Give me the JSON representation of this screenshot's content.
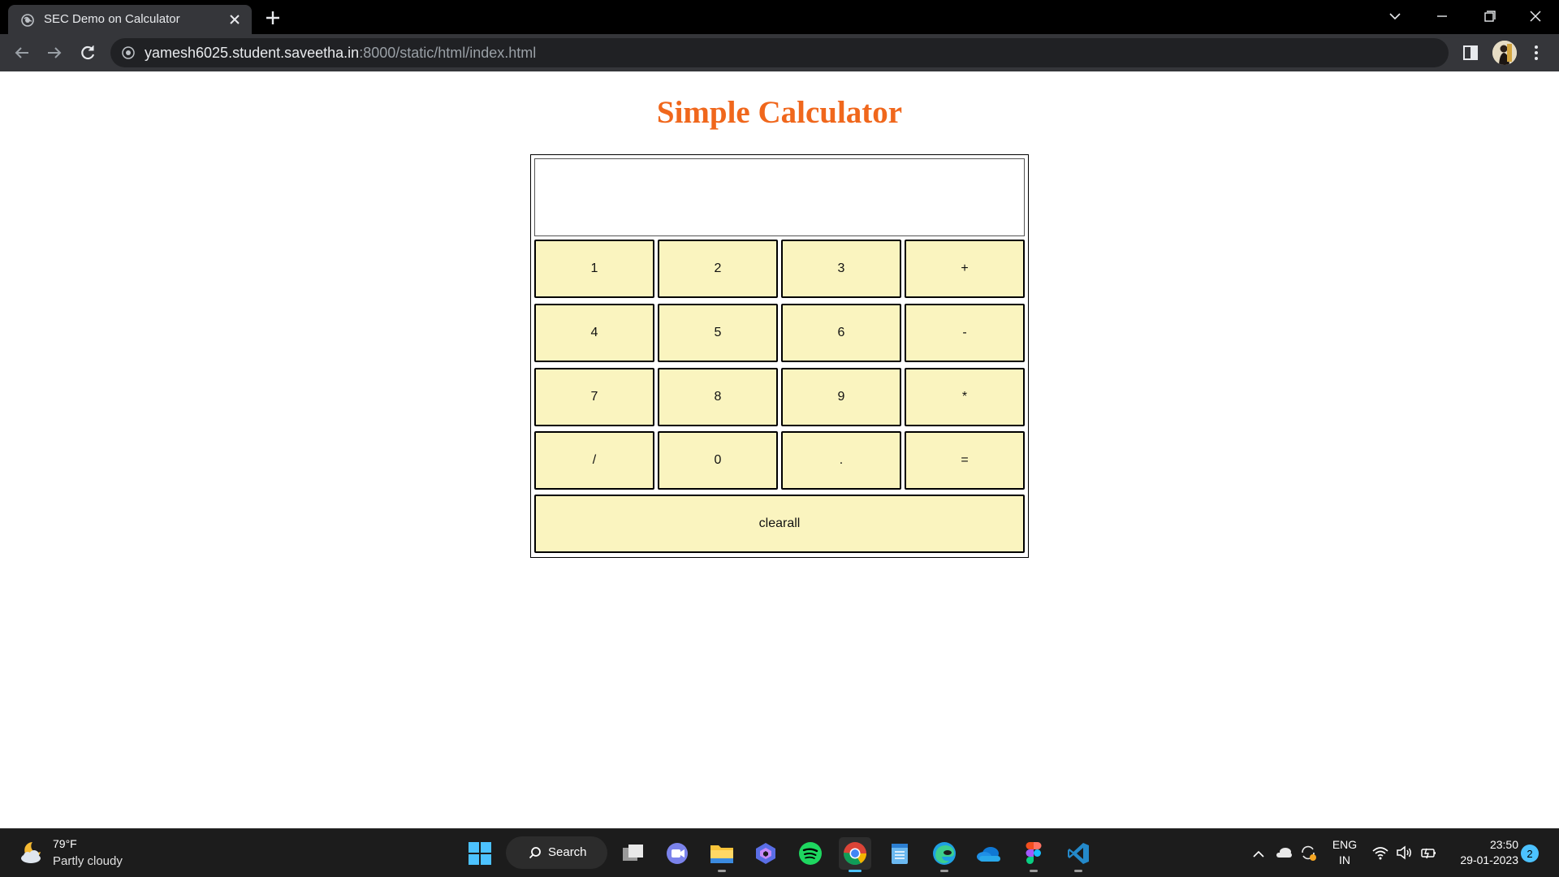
{
  "browser": {
    "tab": {
      "title": "SEC Demo on Calculator",
      "favicon": "globe-icon"
    },
    "url": {
      "host": "yamesh6025.student.saveetha.in",
      "path": ":8000/static/html/index.html"
    }
  },
  "page": {
    "title": "Simple Calculator",
    "title_color": "#f0671c",
    "display_value": "",
    "keys": {
      "k1": "1",
      "k2": "2",
      "k3": "3",
      "plus": "+",
      "k4": "4",
      "k5": "5",
      "k6": "6",
      "minus": "-",
      "k7": "7",
      "k8": "8",
      "k9": "9",
      "multiply": "*",
      "divide": "/",
      "k0": "0",
      "dot": ".",
      "equals": "=",
      "clear": "clearall"
    },
    "key_color": "#faf4bf"
  },
  "taskbar": {
    "weather": {
      "temp": "79°F",
      "desc": "Partly cloudy"
    },
    "search_label": "Search",
    "language": {
      "line1": "ENG",
      "line2": "IN"
    },
    "clock": {
      "time": "23:50",
      "date": "29-01-2023"
    },
    "notification_count": "2",
    "apps": [
      "start-icon",
      "task-view-icon",
      "teams-chat-icon",
      "file-explorer-icon",
      "copilot-icon",
      "spotify-icon",
      "chrome-icon",
      "notepad-icon",
      "edge-icon",
      "onedrive-icon",
      "figma-icon",
      "vscode-icon"
    ]
  }
}
